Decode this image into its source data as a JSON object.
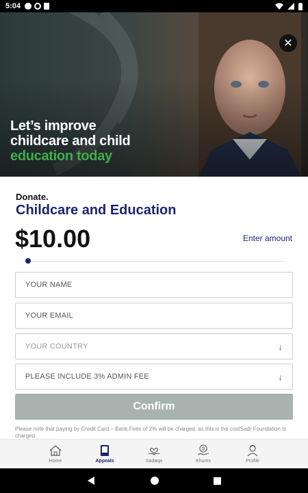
{
  "status_bar": {
    "time": "5:04"
  },
  "hero": {
    "headline_line1": "Let’s improve",
    "headline_line2": "childcare and child",
    "headline_line3": "education today"
  },
  "form": {
    "donate_label": "Donate.",
    "campaign_title": "Childcare and Education",
    "amount": "$10.00",
    "enter_amount": "Enter amount",
    "slider_fraction": 0.0,
    "name_placeholder": "YOUR NAME",
    "email_placeholder": "YOUR EMAIL",
    "country_placeholder": "YOUR COUNTRY",
    "admin_fee_option": "PLEASE INCLUDE 3% ADMIN FEE",
    "confirm_label": "Confirm",
    "note": "Please note that paying by Credit Card – Bank Fees of 2% will be charged, as this is the costSadr Foundation is charged."
  },
  "bottom_nav": {
    "items": [
      {
        "label": "Home",
        "icon": "home-icon"
      },
      {
        "label": "Appeals",
        "icon": "appeals-icon"
      },
      {
        "label": "Sadaqa",
        "icon": "sadaqa-icon"
      },
      {
        "label": "Khums",
        "icon": "khums-icon"
      },
      {
        "label": "Profile",
        "icon": "profile-icon"
      }
    ],
    "active": "Appeals"
  },
  "colors": {
    "brand_navy": "#1a2470",
    "accent_green": "#3fae4b",
    "button_disabled": "#a8b3b0"
  }
}
